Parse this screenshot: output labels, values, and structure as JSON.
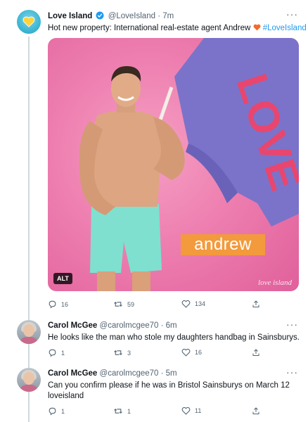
{
  "tweets": [
    {
      "name": "Love Island",
      "handle": "@LoveIsland",
      "time": "· 7m",
      "text_main": "Hot new property: International real-estate agent Andrew ",
      "hashtag": "#LoveIsland",
      "media": {
        "name_plate": "andrew",
        "alt_badge": "ALT",
        "watermark": "love island"
      },
      "replies": "16",
      "retweets": "59",
      "likes": "134"
    },
    {
      "name": "Carol McGee",
      "handle": "@carolmcgee70",
      "time": "· 6m",
      "text": "He looks like the man who stole my daughters handbag in Sainsburys.",
      "replies": "1",
      "retweets": "3",
      "likes": "16"
    },
    {
      "name": "Carol McGee",
      "handle": "@carolmcgee70",
      "time": "· 5m",
      "text_line1": "Can you confirm please if he was in Bristol Sainsburys  on March 12",
      "text_line2": "loveisland",
      "replies": "1",
      "retweets": "1",
      "likes": "11"
    }
  ],
  "more_label": "···",
  "colors": {
    "accent": "#1d9bf0",
    "muted": "#536471",
    "flag": "#7b73c9",
    "flag_text": "#e8466e",
    "backdrop": "#ee7fb0",
    "name_plate": "#f39a3c"
  },
  "icons": [
    "reply-icon",
    "retweet-icon",
    "like-icon",
    "share-icon",
    "verified-icon",
    "more-icon",
    "heart-emoji-icon"
  ]
}
